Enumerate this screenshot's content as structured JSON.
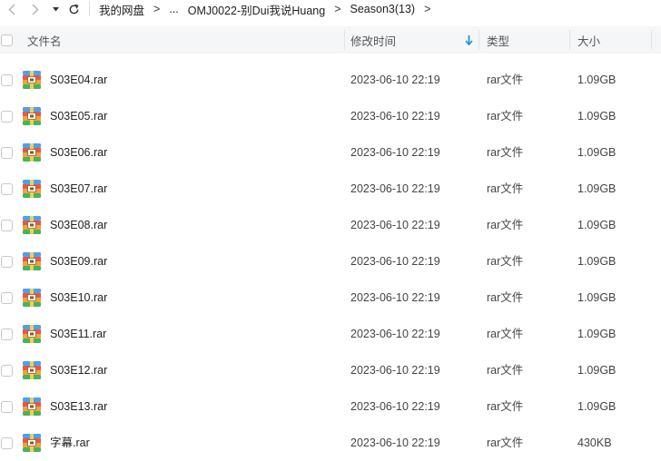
{
  "breadcrumb": {
    "items": [
      "我的网盘",
      "...",
      "OMJ0022-别Dui我说Huang",
      "Season3(13)"
    ],
    "separator": ">"
  },
  "icons": {
    "back": "arrow-left-icon",
    "forward": "arrow-right-icon",
    "dropdown": "caret-down-icon",
    "refresh": "refresh-icon",
    "file": "rar-archive-icon"
  },
  "table": {
    "columns": {
      "name": "文件名",
      "modified": "修改时间",
      "type": "类型",
      "size": "大小"
    },
    "sort": {
      "column": "modified",
      "direction": "descending"
    },
    "rows": [
      {
        "name": "S03E04.rar",
        "modified": "2023-06-10 22:19",
        "type": "rar文件",
        "size": "1.09GB"
      },
      {
        "name": "S03E05.rar",
        "modified": "2023-06-10 22:19",
        "type": "rar文件",
        "size": "1.09GB"
      },
      {
        "name": "S03E06.rar",
        "modified": "2023-06-10 22:19",
        "type": "rar文件",
        "size": "1.09GB"
      },
      {
        "name": "S03E07.rar",
        "modified": "2023-06-10 22:19",
        "type": "rar文件",
        "size": "1.09GB"
      },
      {
        "name": "S03E08.rar",
        "modified": "2023-06-10 22:19",
        "type": "rar文件",
        "size": "1.09GB"
      },
      {
        "name": "S03E09.rar",
        "modified": "2023-06-10 22:19",
        "type": "rar文件",
        "size": "1.09GB"
      },
      {
        "name": "S03E10.rar",
        "modified": "2023-06-10 22:19",
        "type": "rar文件",
        "size": "1.09GB"
      },
      {
        "name": "S03E11.rar",
        "modified": "2023-06-10 22:19",
        "type": "rar文件",
        "size": "1.09GB"
      },
      {
        "name": "S03E12.rar",
        "modified": "2023-06-10 22:19",
        "type": "rar文件",
        "size": "1.09GB"
      },
      {
        "name": "S03E13.rar",
        "modified": "2023-06-10 22:19",
        "type": "rar文件",
        "size": "1.09GB"
      },
      {
        "name": "字幕.rar",
        "modified": "2023-06-10 22:19",
        "type": "rar文件",
        "size": "430KB"
      }
    ]
  },
  "colors": {
    "accent": "#1e88e5",
    "header_bg": "#f5f6f7"
  }
}
